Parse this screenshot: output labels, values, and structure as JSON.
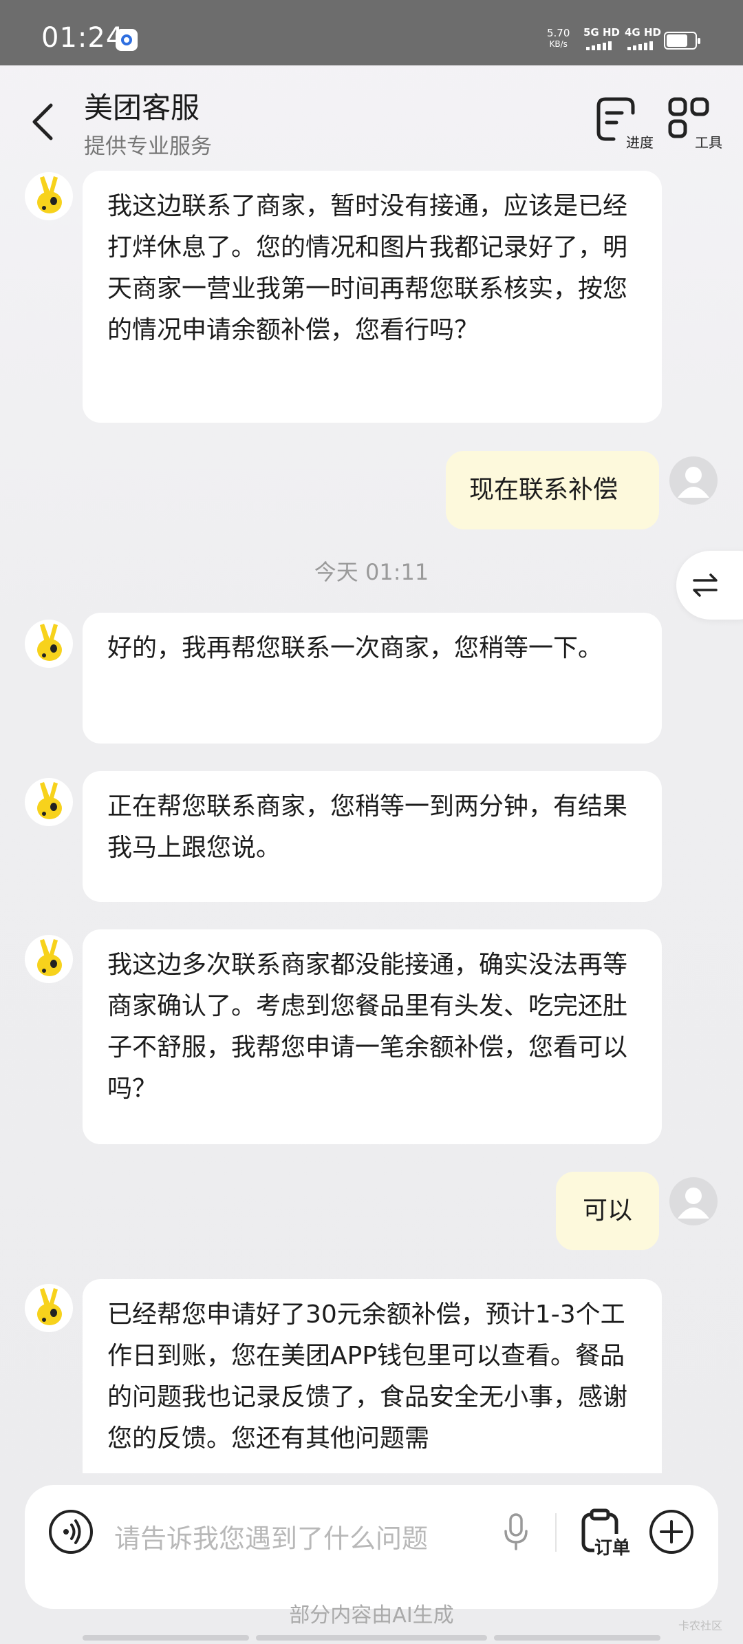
{
  "status_bar": {
    "time": "01:24",
    "speed_value": "5.70",
    "speed_unit": "KB/s",
    "net1": "5G HD",
    "net2": "4G HD"
  },
  "header": {
    "title": "美团客服",
    "subtitle": "提供专业服务",
    "progress_label": "进度",
    "tools_label": "工具"
  },
  "messages": [
    {
      "from": "agent",
      "text": "我这边联系了商家，暂时没有接通，应该是已经打烊休息了。您的情况和图片我都记录好了，明天商家一营业我第一时间再帮您联系核实，按您的情况申请余额补偿，您看行吗？"
    },
    {
      "from": "user",
      "text": "现在联系补偿"
    },
    {
      "from": "agent",
      "text": "好的，我再帮您联系一次商家，您稍等一下。"
    },
    {
      "from": "agent",
      "text": "正在帮您联系商家，您稍等一到两分钟，有结果我马上跟您说。"
    },
    {
      "from": "agent",
      "text": "我这边多次联系商家都没能接通，确实没法再等商家确认了。考虑到您餐品里有头发、吃完还肚子不舒服，我帮您申请一笔余额补偿，您看可以吗？"
    },
    {
      "from": "user",
      "text": "可以"
    },
    {
      "from": "agent",
      "text": "已经帮您申请好了30元余额补偿，预计1-3个工作日到账，您在美团APP钱包里可以查看。餐品的问题我也记录反馈了，食品安全无小事，感谢您的反馈。您还有其他问题需"
    }
  ],
  "timestamp": "今天 01:11",
  "input": {
    "placeholder": "请告诉我您遇到了什么问题",
    "order_label": "订单"
  },
  "footnote": "部分内容由AI生成",
  "watermark": "卡农社区"
}
